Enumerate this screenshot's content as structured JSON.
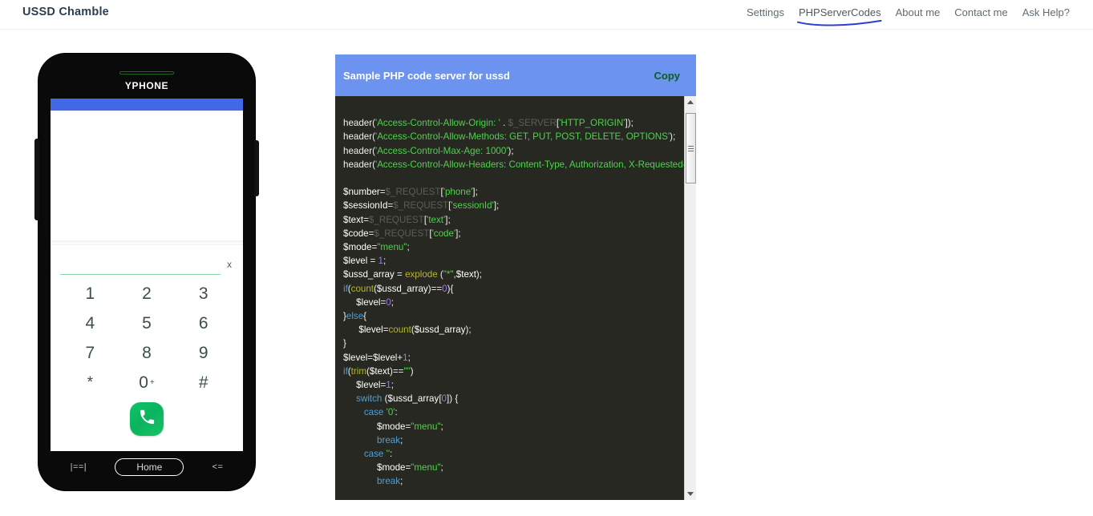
{
  "navbar": {
    "brand": "USSD Chamble",
    "links": [
      {
        "label": "Settings",
        "active": false
      },
      {
        "label": "PHPServerCodes",
        "active": true
      },
      {
        "label": "About me",
        "active": false
      },
      {
        "label": "Contact me",
        "active": false
      },
      {
        "label": "Ask Help?",
        "active": false
      }
    ],
    "accent_underline_color": "#2f3fd0"
  },
  "phone": {
    "label": "YPHONE",
    "topbar_color": "#4169e7",
    "input": {
      "value": "",
      "placeholder": ""
    },
    "clear_label": "x",
    "keypad": [
      {
        "key": "1",
        "sup": ""
      },
      {
        "key": "2",
        "sup": ""
      },
      {
        "key": "3",
        "sup": ""
      },
      {
        "key": "4",
        "sup": ""
      },
      {
        "key": "5",
        "sup": ""
      },
      {
        "key": "6",
        "sup": ""
      },
      {
        "key": "7",
        "sup": ""
      },
      {
        "key": "8",
        "sup": ""
      },
      {
        "key": "9",
        "sup": ""
      },
      {
        "key": "*",
        "sup": ""
      },
      {
        "key": "0",
        "sup": "+"
      },
      {
        "key": "#",
        "sup": ""
      }
    ],
    "call_button": "call-icon",
    "call_button_color": "#0cb35f",
    "nav": {
      "recent": "|==|",
      "home": "Home",
      "back": "<="
    }
  },
  "code_panel": {
    "title": "Sample PHP code server for ussd",
    "copy_label": "Copy",
    "header_color": "#6b93ef",
    "background_color": "#272822",
    "code_lines": [
      "",
      "header('Access-Control-Allow-Origin: ' . $_SERVER['HTTP_ORIGIN']);",
      "header('Access-Control-Allow-Methods: GET, PUT, POST, DELETE, OPTIONS');",
      "header('Access-Control-Max-Age: 1000');",
      "header('Access-Control-Allow-Headers: Content-Type, Authorization, X-Requested-With');",
      "",
      "$number=$_REQUEST['phone'];",
      "$sessionId=$_REQUEST['sessionId'];",
      "$text=$_REQUEST['text'];",
      "$code=$_REQUEST['code'];",
      "$mode=\"menu\";",
      "$level = 1;",
      "$ussd_array = explode (\"*\",$text);",
      "if(count($ussd_array)==0){",
      "     $level=0;",
      "}else{",
      "      $level=count($ussd_array);",
      "}",
      "$level=$level+1;",
      "if(trim($text)==\"\")",
      "     $level=1;",
      "     switch ($ussd_array[0]) {",
      "        case '0':",
      "             $mode=\"menu\";",
      "             break;",
      "        case '':",
      "             $mode=\"menu\";",
      "             break;"
    ],
    "scrollbar": {
      "up_arrow": "scroll-up-icon",
      "down_arrow": "scroll-down-icon",
      "thumb": "scroll-thumb"
    }
  }
}
